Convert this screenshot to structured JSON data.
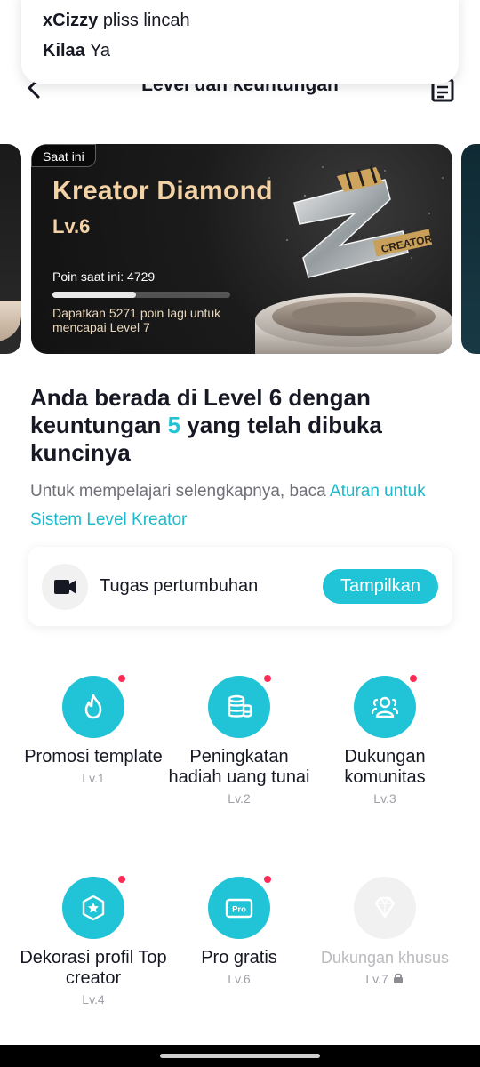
{
  "notification": {
    "messages": [
      {
        "sender": "xCizzy",
        "text": "pliss lincah"
      },
      {
        "sender": "Kilaa",
        "text": "Ya"
      }
    ]
  },
  "header": {
    "title": "Level dan keuntungan"
  },
  "level_card": {
    "badge": "Saat ini",
    "title": "Kreator Diamond",
    "level": "Lv.6",
    "points_text": "Poin saat ini: 4729",
    "progress_fraction": 0.47,
    "subtitle": "Dapatkan 5271 poin lagi untuk mencapai Level 7",
    "trophy_text": "CREATOR"
  },
  "summary": {
    "heading_prefix": "Anda berada di Level 6 dengan keuntungan",
    "heading_count": "5",
    "heading_suffix": "yang telah dibuka kuncinya",
    "info_text": "Untuk mempelajari selengkapnya, baca",
    "info_link": "Aturan untuk Sistem Level Kreator"
  },
  "growth_task": {
    "icon": "video-camera-icon",
    "label": "Tugas pertumbuhan",
    "button": "Tampilkan"
  },
  "benefits": [
    {
      "icon": "flame-icon",
      "label": "Promosi template",
      "level": "Lv.1",
      "new": true,
      "locked": false
    },
    {
      "icon": "coins-icon",
      "label": "Peningkatan hadiah uang tunai",
      "level": "Lv.2",
      "new": true,
      "locked": false
    },
    {
      "icon": "community-icon",
      "label": "Dukungan komunitas",
      "level": "Lv.3",
      "new": true,
      "locked": false
    },
    {
      "icon": "star-badge-icon",
      "label": "Dekorasi profil Top creator",
      "level": "Lv.4",
      "new": true,
      "locked": false
    },
    {
      "icon": "pro-icon",
      "label": "Pro gratis",
      "level": "Lv.6",
      "new": true,
      "locked": false
    },
    {
      "icon": "diamond-icon",
      "label": "Dukungan khusus",
      "level": "Lv.7",
      "new": false,
      "locked": true
    }
  ],
  "colors": {
    "accent": "#20c4d6",
    "notification_dot": "#fe2c55",
    "card_gold": "#f3d2a6"
  }
}
